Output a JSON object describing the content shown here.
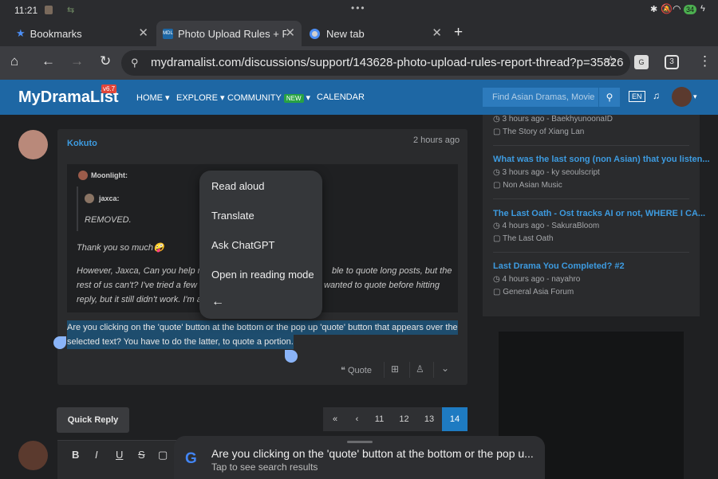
{
  "status": {
    "time": "11:21",
    "battery": "34"
  },
  "tabs": [
    {
      "label": "Bookmarks"
    },
    {
      "label": "Photo Upload Rules + Rep"
    },
    {
      "label": "New tab"
    }
  ],
  "toolbar": {
    "url": "mydramalist.com/discussions/support/143628-photo-upload-rules-report-thread?p=35826",
    "tab_count": "3"
  },
  "site": {
    "logo": "MyDramaList",
    "version": "v6.7",
    "nav": {
      "home": "HOME",
      "explore": "EXPLORE",
      "community": "COMMUNITY",
      "new_badge": "NEW",
      "calendar": "CALENDAR"
    },
    "search_placeholder": "Find Asian Dramas, Movie",
    "lang": "EN"
  },
  "comment": {
    "author": "Kokuto",
    "time": "2 hours ago",
    "quote_author": "Moonlight:",
    "nested_author": "jaxca:",
    "nested_text": "REMOVED.",
    "quote_line1": "Thank you so much🤪",
    "quote_line2_left": "However, Jaxca, Can you help me w",
    "quote_line2_right": "ble to quote long posts, but the",
    "quote_line3_left": "rest of us can't? I've tried a few time",
    "quote_line3_right": "wanted to quote before hitting",
    "quote_line4": "reply, but it still didn't work. I'm a bi",
    "selected_line1": "Are you clicking on the 'quote' button at the bottom or the pop up 'quote' button that appears over the",
    "selected_line2": "selected text? You have to do the latter, to quote a portion.",
    "quote_button": "Quote"
  },
  "context_menu": {
    "read_aloud": "Read aloud",
    "translate": "Translate",
    "ask_chatgpt": "Ask ChatGPT",
    "reading_mode": "Open in reading mode"
  },
  "sidebar": {
    "items": [
      {
        "title": "",
        "meta": "3 hours ago - BaekhyunoonaID",
        "forum": "The Story of Xiang Lan"
      },
      {
        "title": "What was the last song (non Asian) that you listen...",
        "meta": "3 hours ago - ky seoulscript",
        "forum": "Non Asian Music"
      },
      {
        "title": "The Last Oath - Ost tracks AI or not, WHERE I CA...",
        "meta": "4 hours ago - SakuraBloom",
        "forum": "The Last Oath"
      },
      {
        "title": "Last Drama You Completed? #2",
        "meta": "4 hours ago - nayahro",
        "forum": "General Asia Forum"
      }
    ]
  },
  "pagination": {
    "pages": [
      "11",
      "12",
      "13",
      "14"
    ],
    "active": "14"
  },
  "quick_reply": "Quick Reply",
  "editor": {
    "bold": "B",
    "italic": "I",
    "underline": "U",
    "strike": "S"
  },
  "google_sheet": {
    "query": "Are you clicking on the 'quote' button at the bottom or the pop u...",
    "hint": "Tap to see search results"
  }
}
